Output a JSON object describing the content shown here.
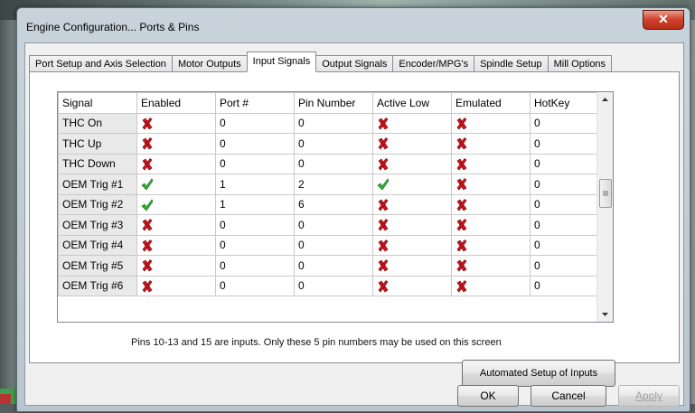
{
  "window": {
    "title": "Engine Configuration... Ports & Pins",
    "close_symbol": "✕"
  },
  "tabs": [
    {
      "label": "Port Setup and Axis Selection",
      "active": false
    },
    {
      "label": "Motor Outputs",
      "active": false
    },
    {
      "label": "Input Signals",
      "active": true
    },
    {
      "label": "Output Signals",
      "active": false
    },
    {
      "label": "Encoder/MPG's",
      "active": false
    },
    {
      "label": "Spindle Setup",
      "active": false
    },
    {
      "label": "Mill Options",
      "active": false
    }
  ],
  "grid": {
    "columns": [
      "Signal",
      "Enabled",
      "Port #",
      "Pin Number",
      "Active Low",
      "Emulated",
      "HotKey"
    ],
    "rows": [
      {
        "signal": "THC On",
        "enabled": "x-icon",
        "port": "0",
        "pin": "0",
        "active_low": "x-icon",
        "emulated": "x-icon",
        "hotkey": "0"
      },
      {
        "signal": "THC Up",
        "enabled": "x-icon",
        "port": "0",
        "pin": "0",
        "active_low": "x-icon",
        "emulated": "x-icon",
        "hotkey": "0"
      },
      {
        "signal": "THC Down",
        "enabled": "x-icon",
        "port": "0",
        "pin": "0",
        "active_low": "x-icon",
        "emulated": "x-icon",
        "hotkey": "0"
      },
      {
        "signal": "OEM Trig #1",
        "enabled": "check-icon",
        "port": "1",
        "pin": "2",
        "active_low": "check-icon",
        "emulated": "x-icon",
        "hotkey": "0"
      },
      {
        "signal": "OEM Trig #2",
        "enabled": "check-icon",
        "port": "1",
        "pin": "6",
        "active_low": "x-icon",
        "emulated": "x-icon",
        "hotkey": "0"
      },
      {
        "signal": "OEM Trig #3",
        "enabled": "x-icon",
        "port": "0",
        "pin": "0",
        "active_low": "x-icon",
        "emulated": "x-icon",
        "hotkey": "0"
      },
      {
        "signal": "OEM Trig #4",
        "enabled": "x-icon",
        "port": "0",
        "pin": "0",
        "active_low": "x-icon",
        "emulated": "x-icon",
        "hotkey": "0"
      },
      {
        "signal": "OEM Trig #5",
        "enabled": "x-icon",
        "port": "0",
        "pin": "0",
        "active_low": "x-icon",
        "emulated": "x-icon",
        "hotkey": "0"
      },
      {
        "signal": "OEM Trig #6",
        "enabled": "x-icon",
        "port": "0",
        "pin": "0",
        "active_low": "x-icon",
        "emulated": "x-icon",
        "hotkey": "0"
      }
    ]
  },
  "note": "Pins 10-13 and 15 are inputs. Only these 5 pin numbers may be used on this screen",
  "buttons": {
    "auto_setup": "Automated Setup of Inputs",
    "ok": "OK",
    "cancel": "Cancel",
    "apply": "Apply"
  },
  "colors": {
    "x_red": "#d1141e",
    "check_green": "#2fb52f",
    "close_red": "#c9402a"
  }
}
